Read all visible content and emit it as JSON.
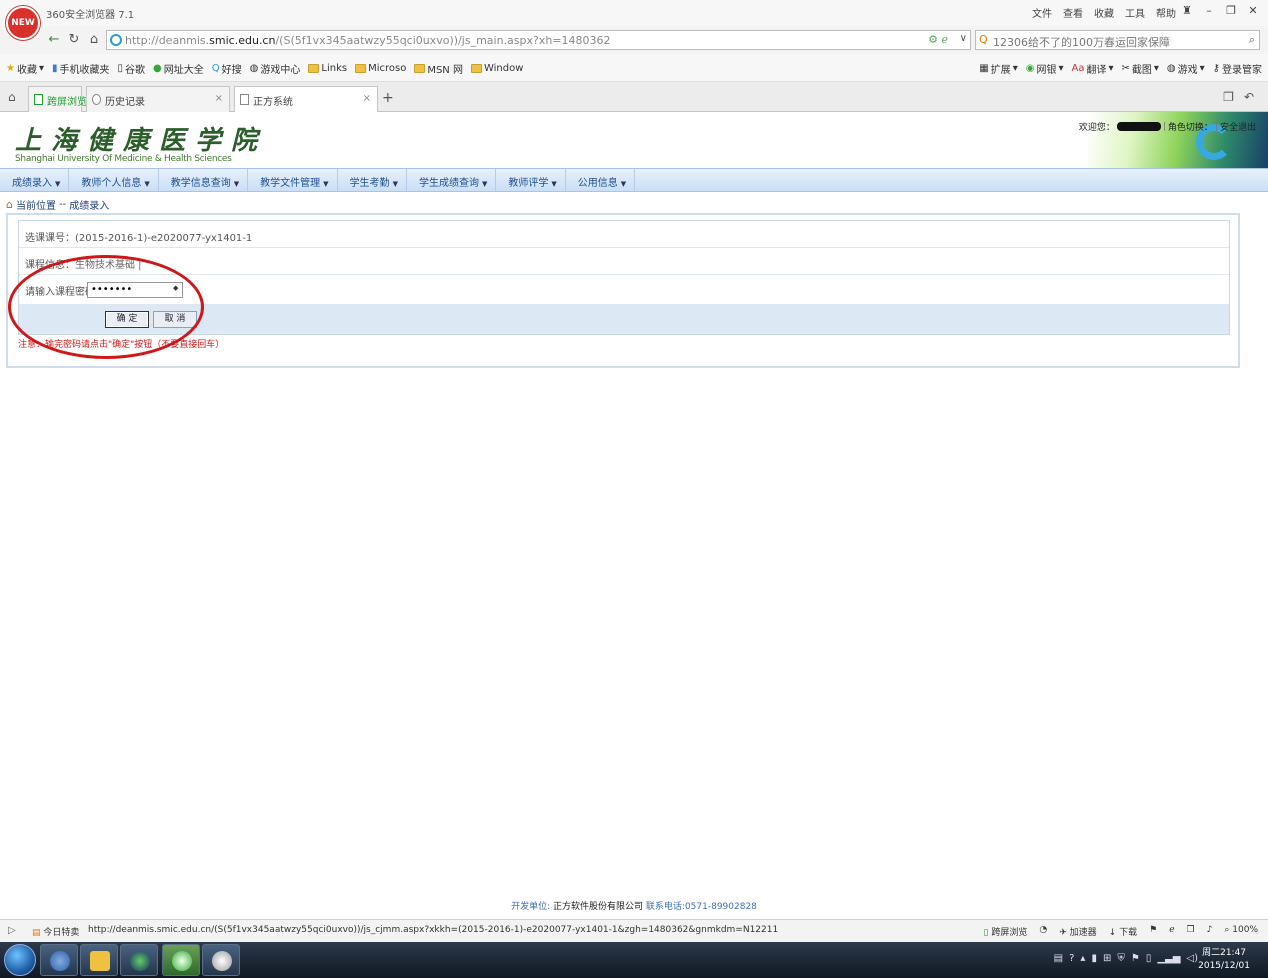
{
  "browser": {
    "app_title": "360安全浏览器 7.1",
    "new_badge": "NEW",
    "menus": [
      "文件",
      "查看",
      "收藏",
      "工具",
      "帮助"
    ],
    "url_prefix": "http://deanmis.",
    "url_domain": "smic.edu.cn",
    "url_rest": "/(S(5f1vx345aatwzy55qci0uxvo))/js_main.aspx?xh=1480362",
    "search_text": "12306给不了的100万春运回家保障",
    "favorites_left": [
      "收藏",
      "手机收藏夹",
      "谷歌",
      "网址大全",
      "好搜",
      "游戏中心",
      "Links",
      "Microso",
      "MSN 网",
      "Window"
    ],
    "favorites_right": [
      "扩展",
      "网银",
      "翻译",
      "截图",
      "游戏",
      "登录管家"
    ],
    "tabs": [
      {
        "label": "跨屏浏览"
      },
      {
        "label": "历史记录"
      },
      {
        "label": "正方系统"
      }
    ]
  },
  "header": {
    "school_cn": "上海健康医学院",
    "school_en": "Shanghai University Of Medicine & Health Sciences",
    "welcome": "欢迎您：",
    "role_switch": "角色切换：",
    "logout": "安全退出"
  },
  "nav": {
    "items": [
      "成绩录入",
      "教师个人信息",
      "教学信息查询",
      "教学文件管理",
      "学生考勤",
      "学生成绩查询",
      "教师评学",
      "公用信息"
    ]
  },
  "breadcrumb": {
    "label": "当前位置",
    "separator": "--",
    "page": "成绩录入"
  },
  "form": {
    "course_code_label": "选课课号：",
    "course_code": "(2015-2016-1)-e2020077-yx1401-1",
    "course_info_label": "课程信息：",
    "course_info": "生物技术基础 |",
    "password_label": "请输入课程密码：",
    "password_value": "•••••••",
    "ok_button": "确 定",
    "cancel_button": "取 消",
    "note": "注意：输完密码请点击\"确定\"按钮（不要直接回车）"
  },
  "footer": {
    "dev_label": "开发单位:",
    "company": "正方软件股份有限公司",
    "phone": "联系电话:0571-89902828"
  },
  "status_bar": {
    "today": "今日特卖",
    "link_url": "http://deanmis.smic.edu.cn/(S(5f1vx345aatwzy55qci0uxvo))/js_cjmm.aspx?xkkh=(2015-2016-1)-e2020077-yx1401-1&zgh=1480362&gnmkdm=N12211",
    "right": [
      "跨屏浏览",
      "加速器",
      "下载",
      "100%"
    ]
  },
  "taskbar": {
    "time": "周二21:47",
    "date": "2015/12/01"
  },
  "colors": {
    "nav_text": "#1f4f8f",
    "note_red": "#d01818",
    "annotation_red": "#cf1717",
    "school_green": "#2b5e2a"
  }
}
